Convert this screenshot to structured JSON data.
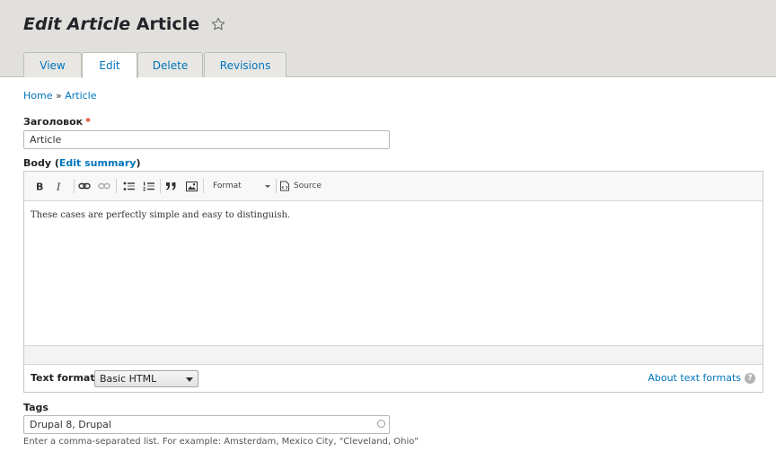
{
  "header": {
    "title_prefix": "Edit Article",
    "title_suffix": "Article",
    "tabs": [
      {
        "label": "View"
      },
      {
        "label": "Edit"
      },
      {
        "label": "Delete"
      },
      {
        "label": "Revisions"
      }
    ]
  },
  "breadcrumb": {
    "home": "Home",
    "separator": "»",
    "current": "Article"
  },
  "title_field": {
    "label": "Заголовок",
    "required_mark": "*",
    "value": "Article"
  },
  "body_field": {
    "label": "Body",
    "open_paren": "(",
    "summary_link": "Edit summary",
    "close_paren": ")",
    "toolbar": {
      "format_label": "Format",
      "source_label": "Source",
      "icons": [
        "bold-icon",
        "italic-icon",
        "link-icon",
        "unlink-icon",
        "bulleted-list-icon",
        "numbered-list-icon",
        "blockquote-icon",
        "image-icon",
        "source-icon"
      ]
    },
    "content": "These cases are perfectly simple and easy to distinguish."
  },
  "text_format": {
    "label": "Text format",
    "selected": "Basic HTML",
    "about_link": "About text formats",
    "help_glyph": "?"
  },
  "tags_field": {
    "label": "Tags",
    "value": "Drupal 8, Drupal",
    "description": "Enter a comma-separated list. For example: Amsterdam, Mexico City, \"Cleveland, Ohio\""
  },
  "colors": {
    "link": "#0074bd",
    "header_bg": "#e1e0dc",
    "required": "#e32700"
  }
}
